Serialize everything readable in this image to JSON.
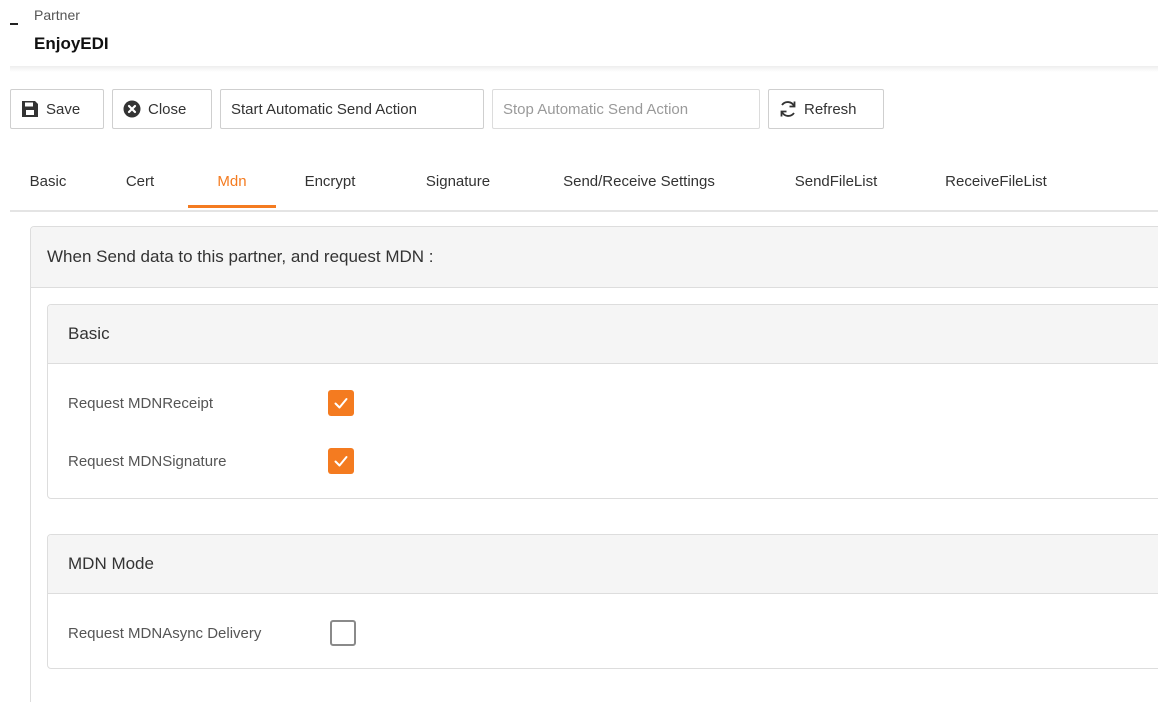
{
  "header": {
    "eyebrow": "Partner",
    "title": "EnjoyEDI"
  },
  "toolbar": {
    "buttons": [
      {
        "label": "Save",
        "icon": "save-icon",
        "disabled": false
      },
      {
        "label": "Close",
        "icon": "close-circle-icon",
        "disabled": false
      },
      {
        "label": "Start Automatic Send Action",
        "disabled": false
      },
      {
        "label": "Stop Automatic Send Action",
        "disabled": true
      },
      {
        "label": "Refresh",
        "icon": "refresh-icon",
        "disabled": false
      }
    ]
  },
  "tabs": [
    {
      "label": "Basic"
    },
    {
      "label": "Cert"
    },
    {
      "label": "Mdn",
      "active": true
    },
    {
      "label": "Encrypt"
    },
    {
      "label": "Signature"
    },
    {
      "label": "Send/Receive Settings"
    },
    {
      "label": "SendFileList"
    },
    {
      "label": "ReceiveFileList"
    }
  ],
  "mdn": {
    "section_title": "When Send data to this partner, and request MDN :",
    "basic": {
      "title": "Basic",
      "fields": [
        {
          "label": "Request MDNReceipt",
          "checked": true
        },
        {
          "label": "Request MDNSignature",
          "checked": true
        }
      ]
    },
    "mode": {
      "title": "MDN Mode",
      "fields": [
        {
          "label": "Request MDNAsync Delivery",
          "checked": false
        }
      ]
    }
  },
  "colors": {
    "accent": "#f47b20",
    "panel_header_bg": "#f5f5f5",
    "border": "#dddddd"
  }
}
